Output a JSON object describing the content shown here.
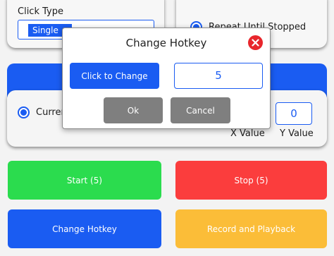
{
  "click_type": {
    "label": "Click Type",
    "selected": "Single"
  },
  "repeat": {
    "option_label": "Repeat Until Stopped"
  },
  "position": {
    "current_option_label": "Current",
    "x_label": "X Value",
    "y_label": "Y Value",
    "y_value": "0"
  },
  "buttons": {
    "start": "Start (5)",
    "stop": "Stop (5)",
    "change_hotkey": "Change Hotkey",
    "record_playback": "Record and Playback"
  },
  "dialog": {
    "title": "Change Hotkey",
    "click_to_change": "Click to Change",
    "hotkey_value": "5",
    "ok": "Ok",
    "cancel": "Cancel"
  },
  "colors": {
    "accent": "#1a5cf2",
    "start": "#2bdc4e",
    "stop": "#fb3d3d",
    "record": "#fbbd38",
    "close": "#e8262c",
    "dialog_button": "#7f7f7f"
  }
}
